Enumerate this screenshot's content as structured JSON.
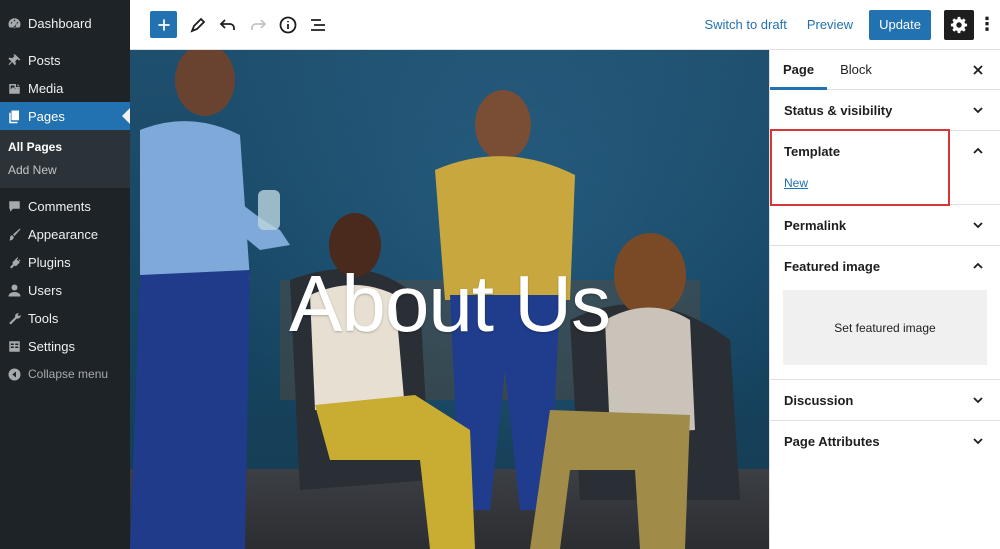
{
  "admin_menu": {
    "dashboard": "Dashboard",
    "items": [
      {
        "label": "Posts",
        "icon": "pushpin-icon"
      },
      {
        "label": "Media",
        "icon": "media-icon"
      },
      {
        "label": "Pages",
        "icon": "pages-icon",
        "active": true
      }
    ],
    "pages_submenu": [
      "All Pages",
      "Add New"
    ],
    "items_after": [
      {
        "label": "Comments",
        "icon": "comment-icon"
      },
      {
        "label": "Appearance",
        "icon": "paintbrush-icon"
      },
      {
        "label": "Plugins",
        "icon": "plugin-icon"
      },
      {
        "label": "Users",
        "icon": "users-icon"
      },
      {
        "label": "Tools",
        "icon": "wrench-icon"
      },
      {
        "label": "Settings",
        "icon": "settings-icon"
      }
    ],
    "collapse": "Collapse menu"
  },
  "toolbar": {
    "switch_to_draft": "Switch to draft",
    "preview": "Preview",
    "update": "Update"
  },
  "cover": {
    "title": "About Us"
  },
  "settings_panel": {
    "tabs": [
      "Page",
      "Block"
    ],
    "active_tab": "Page",
    "sections": {
      "status_visibility": "Status & visibility",
      "template": "Template",
      "template_link": "New",
      "permalink": "Permalink",
      "featured_image": "Featured image",
      "set_featured_image": "Set featured image",
      "discussion": "Discussion",
      "page_attributes": "Page Attributes"
    }
  },
  "colors": {
    "admin_bg": "#1d2327",
    "accent": "#2271b1",
    "highlight": "#d63638"
  }
}
